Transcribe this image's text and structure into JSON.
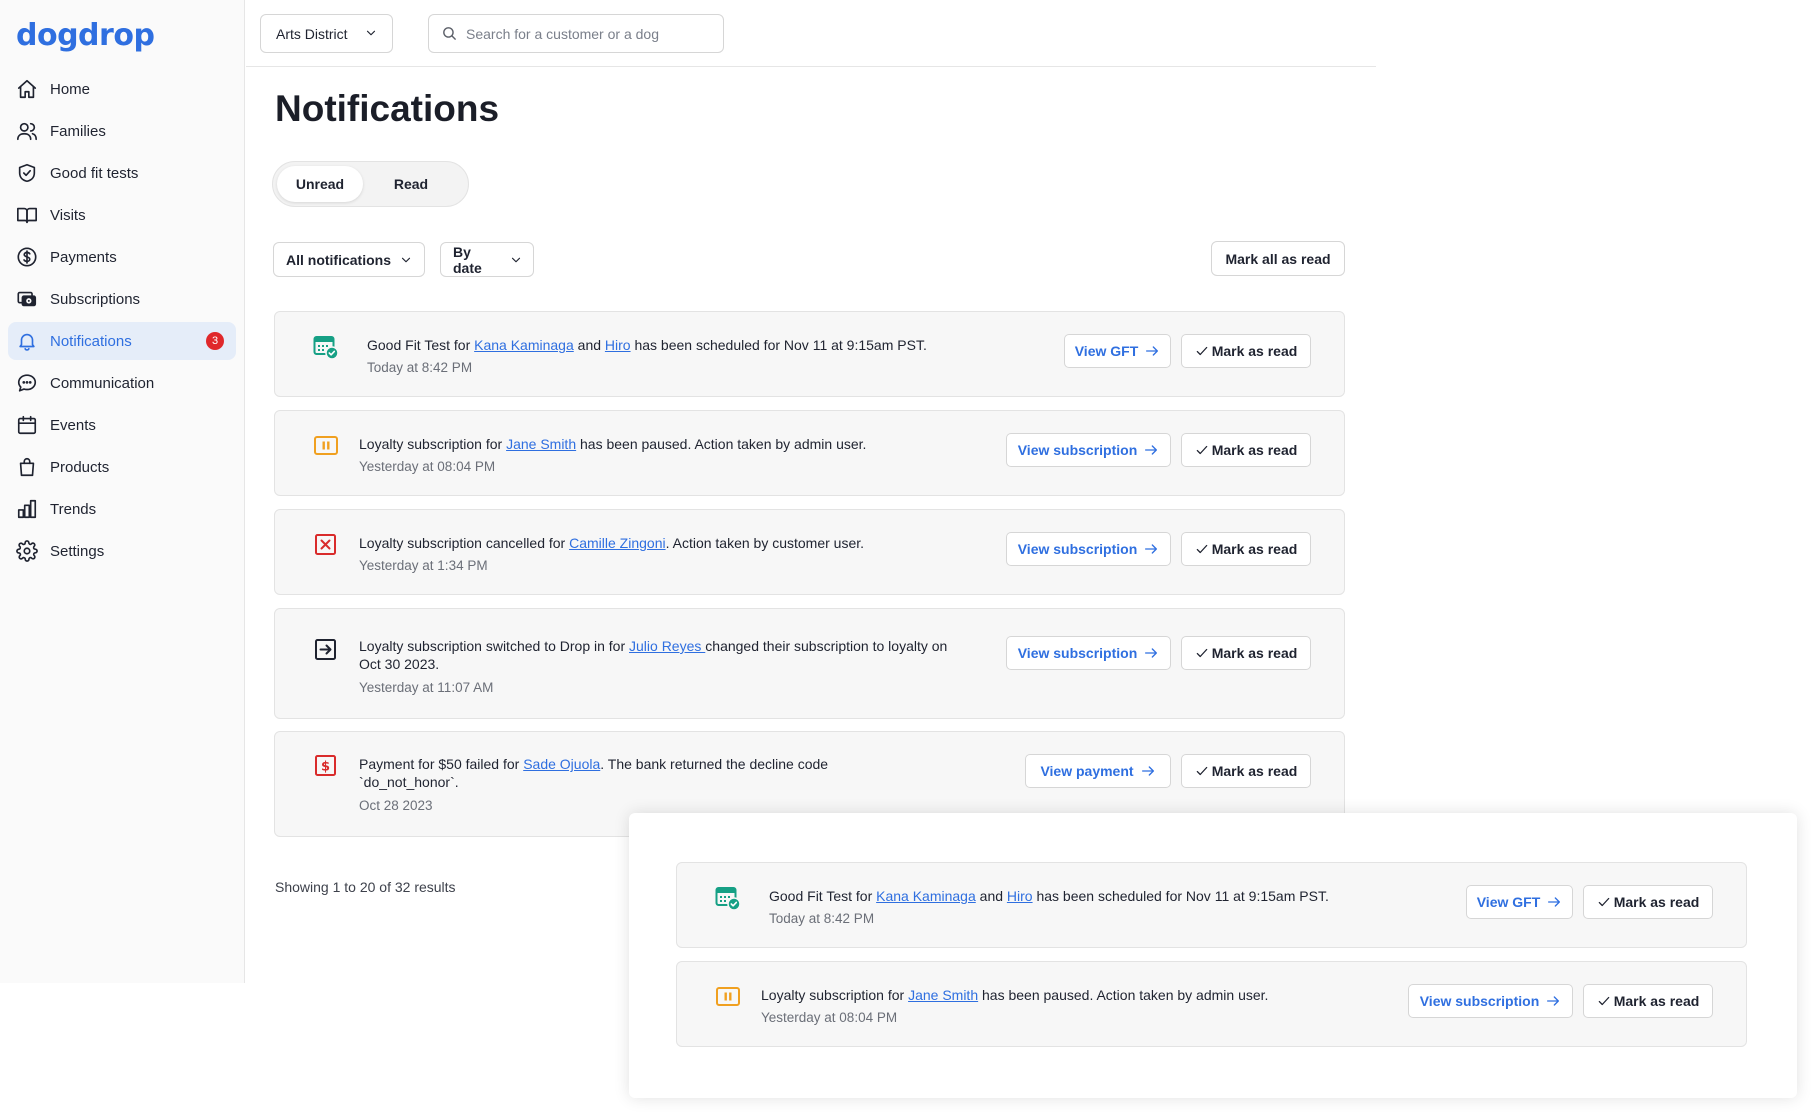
{
  "brand": {
    "logo_text": "dogdrop",
    "accent": "#2f6fe0"
  },
  "sidebar": {
    "items": [
      {
        "label": "Home",
        "icon": "home-icon"
      },
      {
        "label": "Families",
        "icon": "users-icon"
      },
      {
        "label": "Good fit tests",
        "icon": "shield-check-icon"
      },
      {
        "label": "Visits",
        "icon": "book-open-icon"
      },
      {
        "label": "Payments",
        "icon": "dollar-circle-icon"
      },
      {
        "label": "Subscriptions",
        "icon": "subscriptions-icon"
      },
      {
        "label": "Notifications",
        "icon": "bell-icon",
        "active": true,
        "badge": "3"
      },
      {
        "label": "Communication",
        "icon": "chat-bubble-icon"
      },
      {
        "label": "Events",
        "icon": "calendar-icon"
      },
      {
        "label": "Products",
        "icon": "shopping-bag-icon"
      },
      {
        "label": "Trends",
        "icon": "bar-chart-icon"
      },
      {
        "label": "Settings",
        "icon": "gear-icon"
      }
    ]
  },
  "topbar": {
    "location": "Arts District",
    "search_placeholder": "Search for a customer or a dog"
  },
  "main": {
    "title": "Notifications",
    "tabs": [
      {
        "label": "Unread",
        "active": true
      },
      {
        "label": "Read",
        "active": false
      }
    ],
    "filter_type": "All notifications",
    "filter_sort": "By date",
    "mark_all_label": "Mark all as read",
    "mark_label": "Mark as read",
    "results_text": "Showing 1 to 20 of 32 results",
    "notifications": [
      {
        "icon": "calendar-check-icon",
        "parts": [
          "Good Fit Test for ",
          "Kana Kaminaga",
          " and ",
          "Hiro",
          " has been scheduled for Nov 11 at 9:15am PST."
        ],
        "time": "Today at 8:42 PM",
        "action": "View GFT"
      },
      {
        "icon": "pause-icon",
        "parts": [
          "Loyalty subscription for ",
          "Jane Smith",
          " has been paused. Action taken by admin user."
        ],
        "time": "Yesterday at 08:04 PM",
        "action": "View subscription"
      },
      {
        "icon": "close-box-icon",
        "parts": [
          "Loyalty subscription cancelled for ",
          "Camille Zingoni",
          ". Action taken by customer user."
        ],
        "time": "Yesterday at 1:34 PM",
        "action": "View subscription"
      },
      {
        "icon": "switch-arrow-icon",
        "parts": [
          "Loyalty subscription switched to Drop in for ",
          "Julio Reyes ",
          "changed their subscription to loyalty on Oct 30 2023."
        ],
        "time": "Yesterday at 11:07 AM",
        "action": "View subscription"
      },
      {
        "icon": "payment-failed-icon",
        "parts": [
          "Payment for $50 failed for ",
          "Sade Ojuola",
          ". The bank returned the decline code `do_not_honor`."
        ],
        "time": "Oct 28 2023",
        "action": "View payment"
      }
    ]
  },
  "overlay": {
    "notifications": [
      {
        "icon": "calendar-check-icon",
        "parts": [
          "Good Fit Test for ",
          "Kana Kaminaga",
          " and ",
          "Hiro",
          " has been scheduled for Nov 11 at 9:15am PST."
        ],
        "time": "Today at 8:42 PM",
        "action": "View GFT"
      },
      {
        "icon": "pause-icon",
        "parts": [
          "Loyalty subscription for ",
          "Jane Smith",
          " has been paused. Action taken by admin user."
        ],
        "time": "Yesterday at 08:04 PM",
        "action": "View subscription"
      }
    ]
  }
}
